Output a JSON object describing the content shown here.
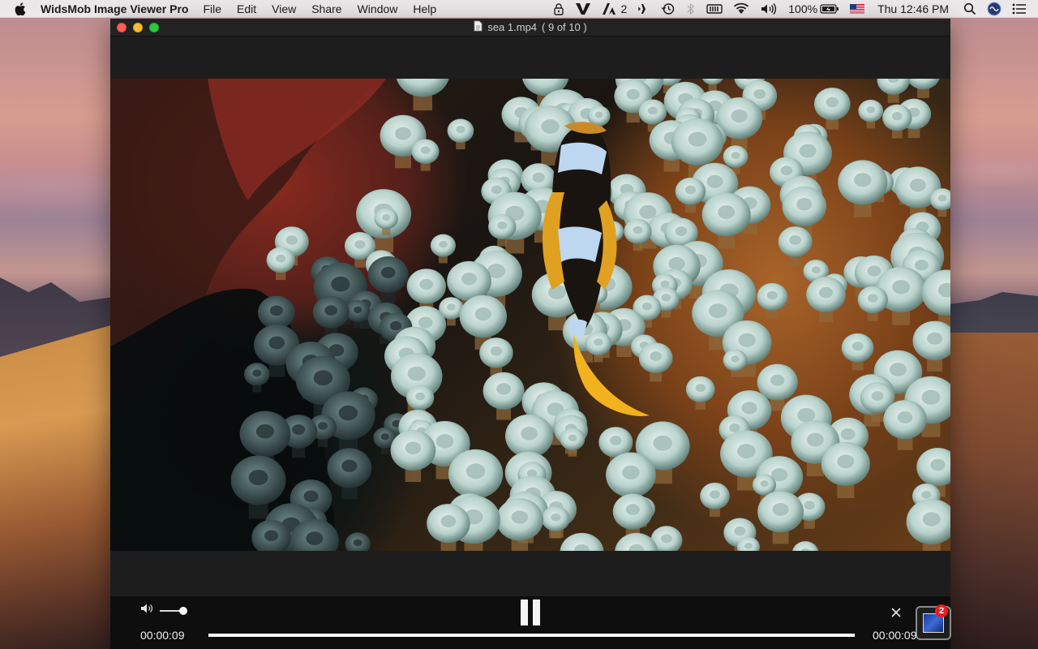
{
  "menubar": {
    "app_name": "WidsMob Image Viewer Pro",
    "items": [
      "File",
      "Edit",
      "View",
      "Share",
      "Window",
      "Help"
    ],
    "status": {
      "adobe_count": "2",
      "battery": "100%",
      "clock": "Thu 12:46 PM"
    }
  },
  "window": {
    "title": "sea 1.mp4",
    "counter": "( 9 of 10 )"
  },
  "player": {
    "current_time": "00:00:09",
    "total_time": "00:00:09",
    "progress": 1.0,
    "volume": 1.0,
    "thumbnail_badge": "2"
  },
  "colors": {
    "accent_red": "#f01c1c",
    "traffic_close": "#fc5f57",
    "traffic_min": "#fdbb2e",
    "traffic_max": "#29c940"
  }
}
